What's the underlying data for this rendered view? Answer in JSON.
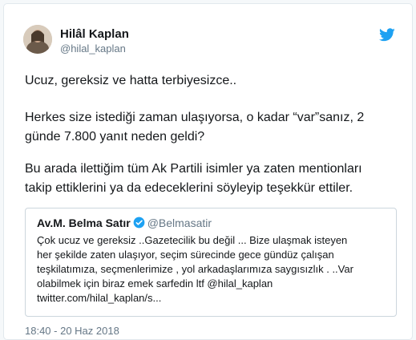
{
  "author": {
    "name": "Hilâl Kaplan",
    "handle": "@hilal_kaplan"
  },
  "tweet": {
    "line1": "Ucuz, gereksiz ve hatta terbiyesizce..",
    "para2_line1": "Herkes size istediği zaman ulaşıyorsa, o kadar “var”sanız, 2",
    "para2_line2": "günde 7.800 yanıt neden geldi?",
    "para3_line1": "Bu arada ilettiğim tüm Ak Partili isimler ya zaten mentionları",
    "para3_line2": "takip ettiklerini ya da edeceklerini söyleyip teşekkür ettiler."
  },
  "quoted": {
    "name": "Av.M. Belma Satır",
    "handle": "@Belmasatir",
    "lines": [
      "Çok ucuz ve gereksiz ..Gazetecilik bu değil ... Bize ulaşmak isteyen",
      "her şekilde zaten ulaşıyor, seçim sürecinde gece gündüz çalışan",
      "teşkilatımıza, seçmenlerimize , yol arkadaşlarımıza saygısızlık . ..Var",
      "olabilmek için biraz emek sarfedin ltf @hilal_kaplan",
      "twitter.com/hilal_kaplan/s..."
    ]
  },
  "date": "18:40 - 20 Haz 2018",
  "icons": {
    "brand": "twitter-bird-icon",
    "verified": "verified-badge-icon"
  },
  "colors": {
    "twitter_blue": "#1da1f2",
    "text": "#14171a",
    "muted": "#657786"
  }
}
